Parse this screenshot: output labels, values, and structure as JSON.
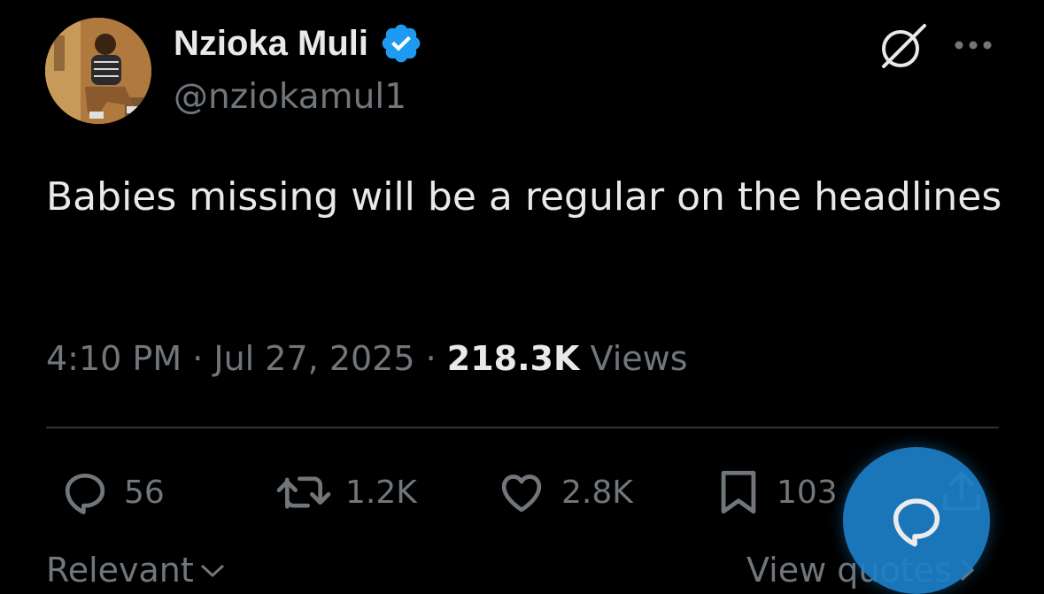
{
  "user": {
    "display_name": "Nzioka Muli",
    "handle": "@nziokamul1",
    "verified_icon": "verified-badge-icon",
    "verified_color": "#1d9bf0"
  },
  "tweet": {
    "text": "Babies missing will be a regular on the headlines",
    "time": "4:10 PM",
    "date": "Jul 27, 2025",
    "views_count": "218.3K",
    "views_label": "Views"
  },
  "actions": {
    "replies": "56",
    "reposts": "1.2K",
    "likes": "2.8K",
    "bookmarks": "103"
  },
  "footer": {
    "sort_label": "Relevant",
    "quotes_label": "View quotes"
  },
  "colors": {
    "background": "#000000",
    "text_primary": "#e7e9ea",
    "text_secondary": "#71767b",
    "fab": "#1d80c8"
  }
}
